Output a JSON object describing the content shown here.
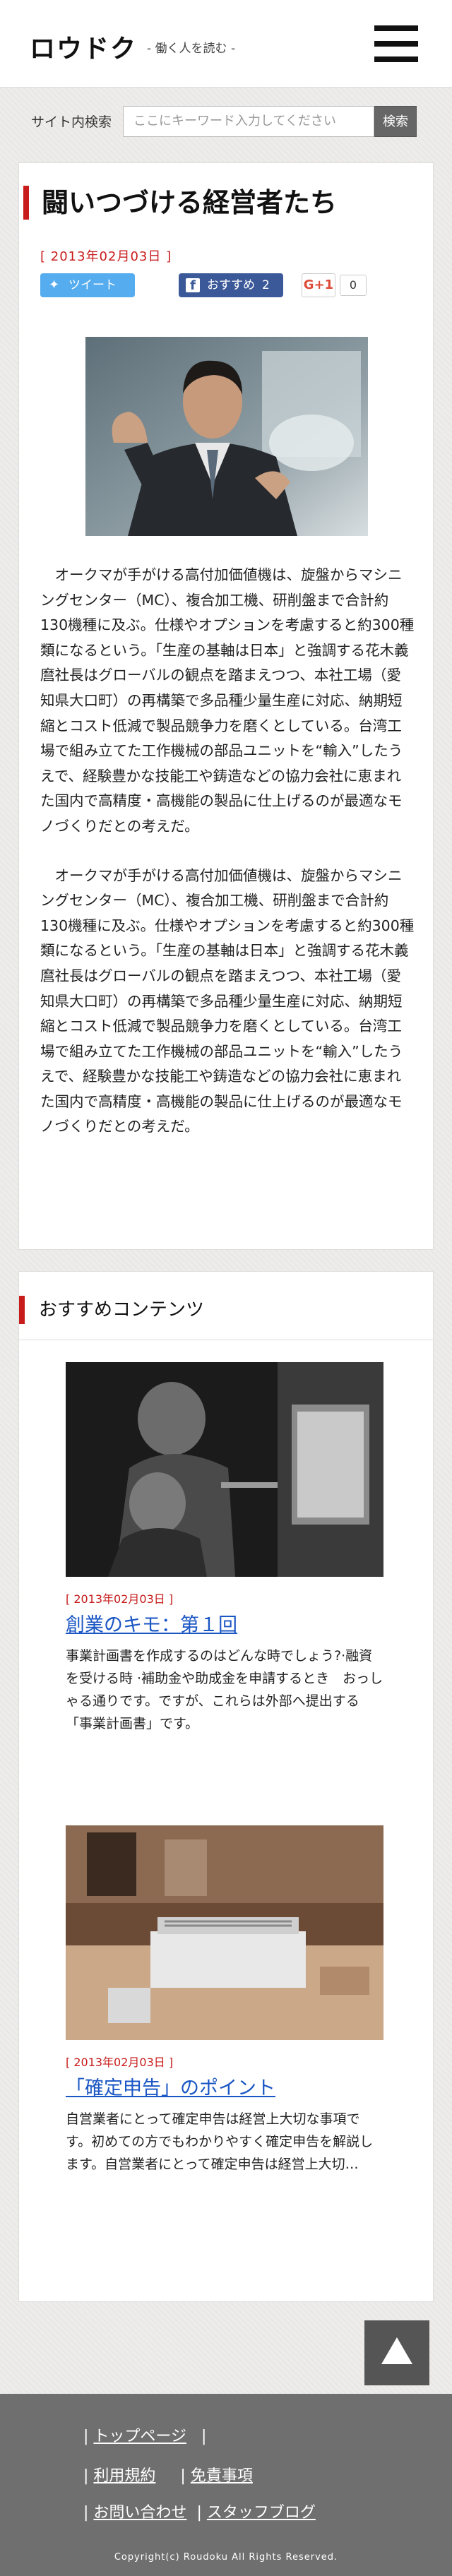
{
  "header": {
    "logo": "ロウドク",
    "tagline": "- 働く人を読む -"
  },
  "search": {
    "label": "サイト内検索",
    "placeholder": "ここにキーワード入力してください",
    "button": "検索"
  },
  "article": {
    "title": "闘いつづける経営者たち",
    "date": "[ 2013年02月03日 ]",
    "share": {
      "tweet": "ツイート",
      "facebook": "おすすめ",
      "facebook_count": "2",
      "gplus": "G+1",
      "gplus_count": "0"
    },
    "paragraphs": [
      "オークマが手がける高付加価値機は、旋盤からマシニングセンター（MC）、複合加工機、研削盤まで合計約130機種に及ぶ。仕様やオプションを考慮すると約300種類になるという。「生産の基軸は日本」と強調する花木義麿社長はグローバルの観点を踏まえつつ、本社工場（愛知県大口町）の再構築で多品種少量生産に対応、納期短縮とコスト低減で製品競争力を磨くとしている。台湾工場で組み立てた工作機械の部品ユニットを“輸入”したうえで、経験豊かな技能工や鋳造などの協力会社に恵まれた国内で高精度・高機能の製品に仕上げるのが最適なモノづくりだとの考えだ。",
      "オークマが手がける高付加価値機は、旋盤からマシニングセンター（MC）、複合加工機、研削盤まで合計約130機種に及ぶ。仕様やオプションを考慮すると約300種類になるという。「生産の基軸は日本」と強調する花木義麿社長はグローバルの観点を踏まえつつ、本社工場（愛知県大口町）の再構築で多品種少量生産に対応、納期短縮とコスト低減で製品競争力を磨くとしている。台湾工場で組み立てた工作機械の部品ユニットを“輸入”したうえで、経験豊かな技能工や鋳造などの協力会社に恵まれた国内で高精度・高機能の製品に仕上げるのが最適なモノづくりだとの考えだ。"
    ]
  },
  "recommended": {
    "title": "おすすめコンテンツ",
    "items": [
      {
        "date": "[ 2013年02月03日 ]",
        "link": "創業のキモ：第１回",
        "desc": "事業計画書を作成するのはどんな時でしょう?·融資を受ける時 ·補助金や助成金を申請するとき　おっしゃる通りです。ですが、これらは外部へ提出する「事業計画書」です。"
      },
      {
        "date": "[ 2013年02月03日 ]",
        "link": "「確定申告」のポイント",
        "desc": "自営業者にとって確定申告は経営上大切な事項です。初めての方でもわかりやすく確定申告を解説します。自営業者にとって確定申告は経営上大切…"
      }
    ]
  },
  "footer": {
    "nav": {
      "top": "トップページ",
      "terms": "利用規約",
      "disclaimer": "免責事項",
      "contact": "お問い合わせ",
      "blog": "スタッフブログ"
    },
    "separator": "|",
    "copyright": "Copyright(c) Roudoku All Rights Reserved."
  },
  "colors": {
    "accent": "#c81b1b",
    "link": "#1a56c4",
    "footer": "#6f6f6f",
    "tweet": "#55acee",
    "facebook": "#3b5998"
  }
}
